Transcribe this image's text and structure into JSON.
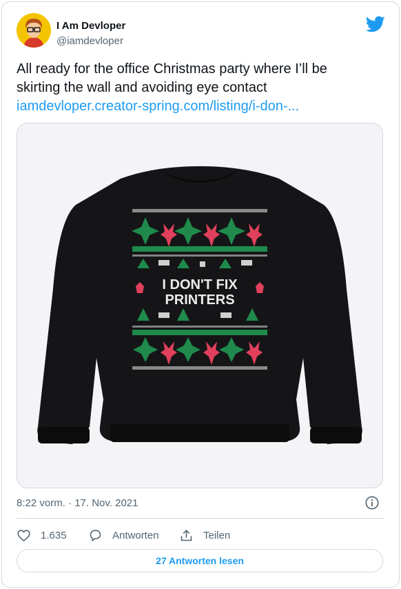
{
  "author": {
    "name": "I Am Devloper",
    "handle": "@iamdevloper"
  },
  "tweet": {
    "text_line1": "All ready for the office Christmas party where I’ll be",
    "text_line2": "skirting the wall and avoiding eye contact",
    "link": "iamdevloper.creator-spring.com/listing/i-don-..."
  },
  "media": {
    "sweater_text_line1": "I DON'T FIX",
    "sweater_text_line2": "PRINTERS",
    "sweater_color": "#151517",
    "accent_red": "#e0405b",
    "accent_green": "#1f8a4c"
  },
  "meta": {
    "timestamp": "8:22 vorm. · 17. Nov. 2021"
  },
  "actions": {
    "likes": "1.635",
    "reply_label": "Antworten",
    "share_label": "Teilen"
  },
  "footer": {
    "read_replies": "27 Antworten lesen"
  },
  "colors": {
    "twitter_blue": "#1d9bf0",
    "text_secondary": "#536471",
    "border": "#cfd9de"
  },
  "icons": [
    "twitter-bird-icon",
    "info-icon",
    "heart-icon",
    "reply-icon",
    "share-icon"
  ]
}
